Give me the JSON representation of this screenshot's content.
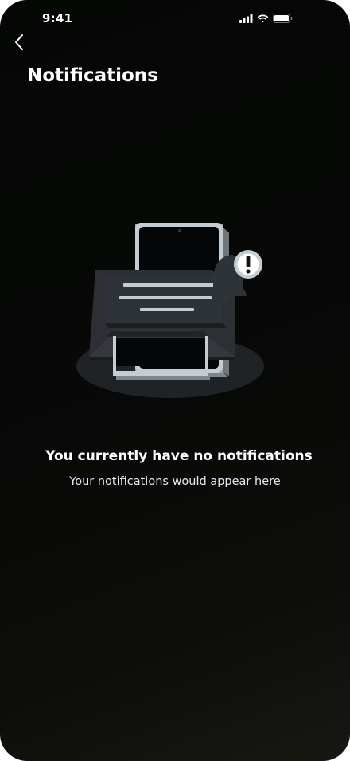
{
  "status_bar": {
    "time": "9:41"
  },
  "header": {
    "back_icon": "chevron-left-icon",
    "title": "Notifications"
  },
  "empty_state": {
    "illustration": "phone-envelope-alert-illustration",
    "title": "You currently have no notifications",
    "subtitle": "Your notifications would appear here"
  },
  "colors": {
    "background": "#070807",
    "text_primary": "#ffffff",
    "illustration_dark": "#2b2f33",
    "illustration_light": "#c5cdd2"
  }
}
